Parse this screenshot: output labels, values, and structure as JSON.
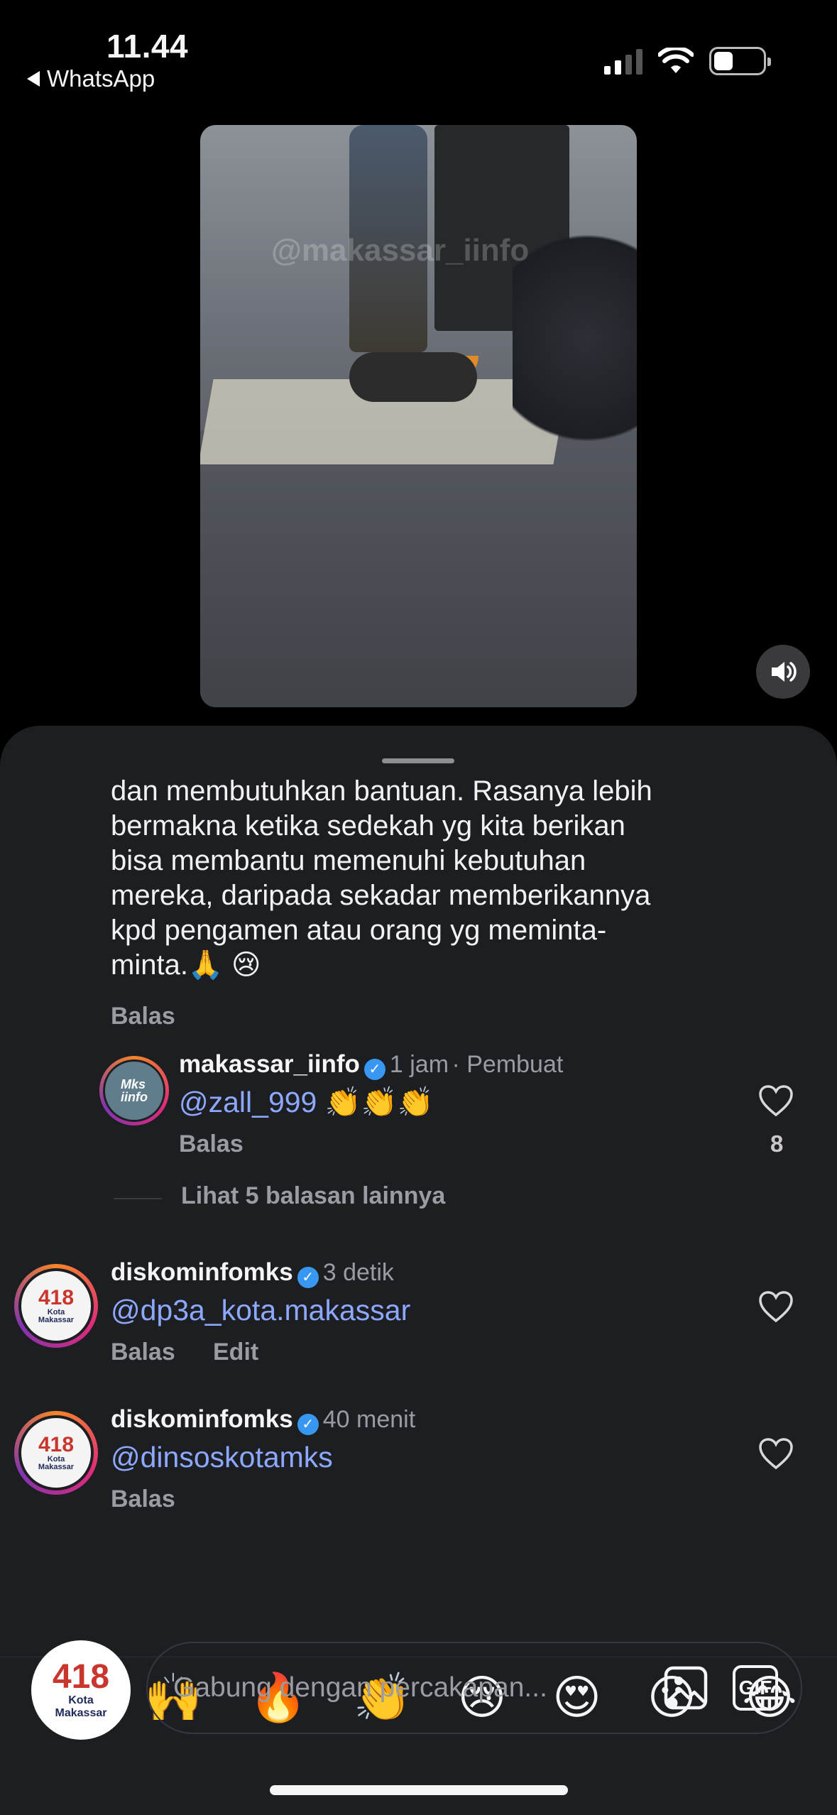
{
  "status": {
    "time": "11.44",
    "back_app": "WhatsApp"
  },
  "video": {
    "watermark": "@makassar_iinfo"
  },
  "comment": {
    "lines": [
      "dan membutuhkan bantuan. Rasanya lebih",
      "bermakna ketika sedekah yg kita berikan",
      "bisa membantu memenuhi kebutuhan",
      "mereka, daripada sekadar memberikannya",
      "kpd pengamen atau orang yg meminta-",
      "minta.🙏 😢"
    ],
    "reply_label": "Balas"
  },
  "reply": {
    "username": "makassar_iinfo",
    "time": "1 jam",
    "role": "· Pembuat",
    "text": "@zall_999 👏👏👏",
    "reply_label": "Balas",
    "likes": "8",
    "avatar_text": "Makassar iinfo"
  },
  "more_replies": "Lihat 5 balasan lainnya",
  "comments": [
    {
      "username": "diskominfomks",
      "time": "3 detik",
      "text": "@dp3a_kota.makassar",
      "reply_label": "Balas",
      "edit_label": "Edit"
    },
    {
      "username": "diskominfomks",
      "time": "40 menit",
      "text": "@dinsoskotamks",
      "reply_label": "Balas"
    }
  ],
  "avatar_logo": {
    "num": "418",
    "line1": "Kota",
    "line2": "Makassar"
  },
  "emojis": [
    "❤️",
    "🙌",
    "🔥",
    "👏",
    "😢",
    "😍",
    "😮",
    "😂"
  ],
  "composer": {
    "placeholder": "Gabung dengan percakapan...",
    "gif_label": "GIF"
  }
}
